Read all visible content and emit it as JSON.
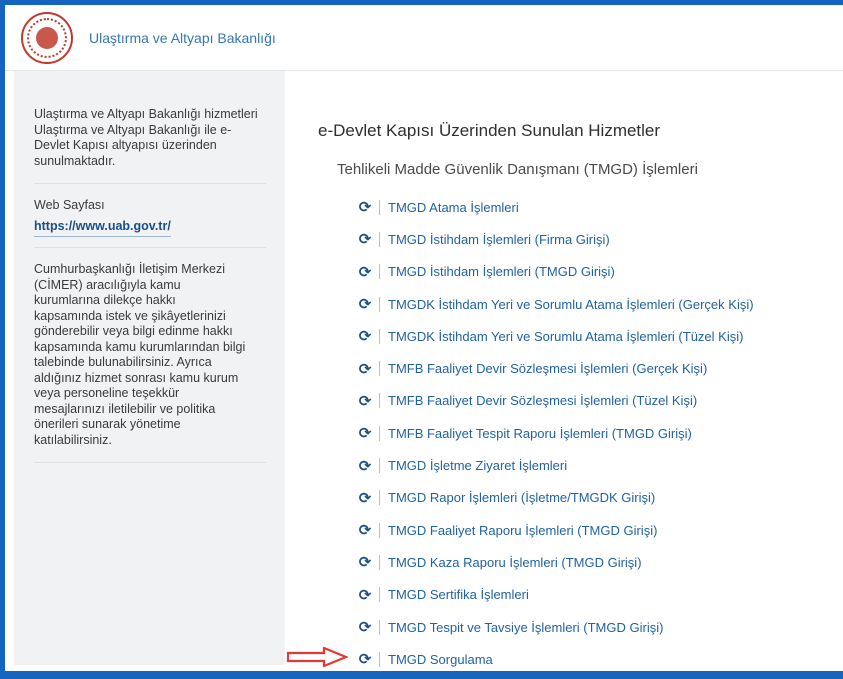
{
  "header": {
    "title": "Ulaştırma ve Altyapı Bakanlığı",
    "logo_icon": "ministry-seal-icon"
  },
  "sidebar": {
    "intro": "Ulaştırma ve Altyapı Bakanlığı hizmetleri Ulaştırma ve Altyapı Bakanlığı ile e-Devlet Kapısı altyapısı üzerinden sunulmaktadır.",
    "website_label": "Web Sayfası",
    "website_link": "https://www.uab.gov.tr/",
    "cimer_text": "Cumhurbaşkanlığı İletişim Merkezi (CİMER) aracılığıyla kamu kurumlarına dilekçe hakkı kapsamında istek ve şikâyetlerinizi gönderebilir veya bilgi edinme hakkı kapsamında kamu kurumlarından bilgi talebinde bulunabilirsiniz. Ayrıca aldığınız hizmet sonrası kamu kurum veya personeline teşekkür mesajlarınızı iletilebilir ve politika önerileri sunarak yönetime katılabilirsiniz."
  },
  "main": {
    "title": "e-Devlet Kapısı Üzerinden Sunulan Hizmetler",
    "section_title": "Tehlikeli Madde Güvenlik Danışmanı (TMGD) İşlemleri",
    "services": [
      {
        "label": "TMGD Atama İşlemleri"
      },
      {
        "label": "TMGD İstihdam İşlemleri (Firma Girişi)"
      },
      {
        "label": "TMGD İstihdam İşlemleri (TMGD Girişi)"
      },
      {
        "label": "TMGDK İstihdam Yeri ve Sorumlu Atama İşlemleri (Gerçek Kişi)"
      },
      {
        "label": "TMGDK İstihdam Yeri ve Sorumlu Atama İşlemleri (Tüzel Kişi)"
      },
      {
        "label": "TMFB Faaliyet Devir Sözleşmesi İşlemleri (Gerçek Kişi)"
      },
      {
        "label": "TMFB Faaliyet Devir Sözleşmesi İşlemleri (Tüzel Kişi)"
      },
      {
        "label": "TMFB Faaliyet Tespit Raporu İşlemleri (TMGD Girişi)"
      },
      {
        "label": "TMGD İşletme Ziyaret İşlemleri"
      },
      {
        "label": "TMGD Rapor İşlemleri (İşletme/TMGDK Girişi)"
      },
      {
        "label": "TMGD Faaliyet Raporu İşlemleri (TMGD Girişi)"
      },
      {
        "label": "TMGD Kaza Raporu İşlemleri (TMGD Girişi)"
      },
      {
        "label": "TMGD Sertifika İşlemleri"
      },
      {
        "label": "TMGD Tespit ve Tavsiye İşlemleri (TMGD Girişi)"
      },
      {
        "label": "TMGD Sorgulama"
      }
    ],
    "service_icon": "refresh-icon"
  },
  "colors": {
    "frame_border": "#1565c0",
    "link": "#1f62a5",
    "arrow": "#e53935"
  }
}
